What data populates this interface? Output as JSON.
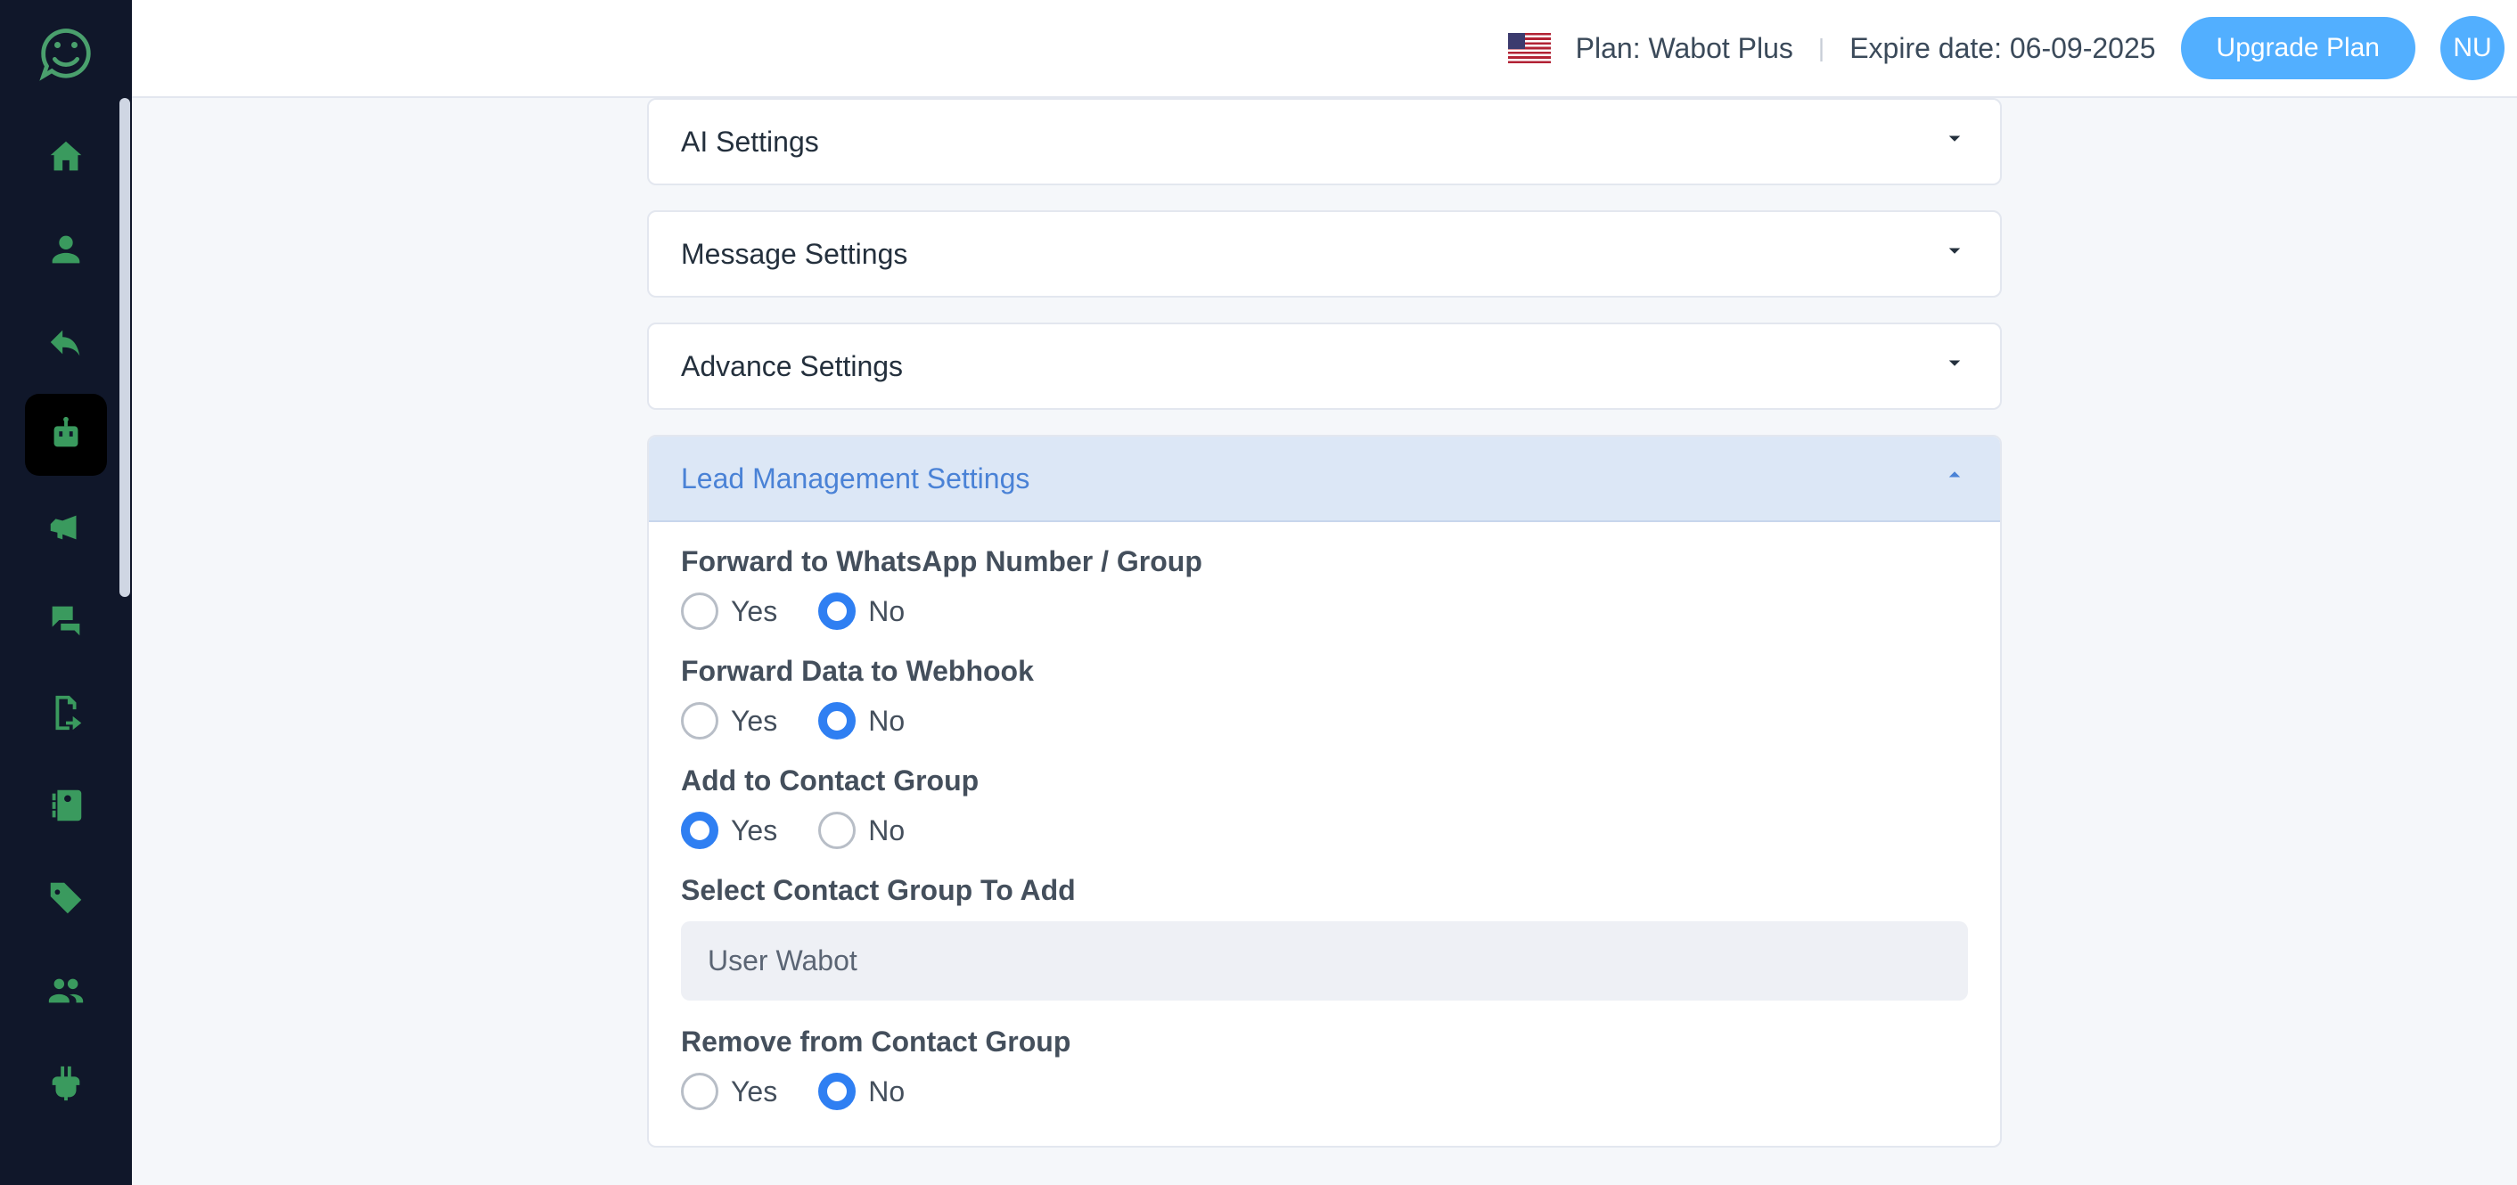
{
  "header": {
    "plan_prefix": "Plan: ",
    "plan_name": "Wabot Plus",
    "expire_prefix": "Expire date: ",
    "expire_date": "06-09-2025",
    "upgrade_label": "Upgrade Plan",
    "avatar_initials": "NU"
  },
  "sidebar": {
    "items": [
      {
        "name": "home",
        "active": false
      },
      {
        "name": "user",
        "active": false
      },
      {
        "name": "reply",
        "active": false
      },
      {
        "name": "bot",
        "active": true
      },
      {
        "name": "megaphone",
        "active": false
      },
      {
        "name": "chat",
        "active": false
      },
      {
        "name": "export",
        "active": false
      },
      {
        "name": "contacts",
        "active": false
      },
      {
        "name": "tags",
        "active": false
      },
      {
        "name": "group",
        "active": false
      },
      {
        "name": "plugin",
        "active": false
      }
    ]
  },
  "accordions": {
    "ai": {
      "title": "AI Settings",
      "expanded": false
    },
    "message": {
      "title": "Message Settings",
      "expanded": false
    },
    "advance": {
      "title": "Advance Settings",
      "expanded": false
    },
    "lead": {
      "title": "Lead Management Settings",
      "expanded": true
    }
  },
  "lead_settings": {
    "forward_whatsapp": {
      "label": "Forward to WhatsApp Number / Group",
      "options": {
        "yes": "Yes",
        "no": "No"
      },
      "selected": "no"
    },
    "forward_webhook": {
      "label": "Forward Data to Webhook",
      "options": {
        "yes": "Yes",
        "no": "No"
      },
      "selected": "no"
    },
    "add_contact_group": {
      "label": "Add to Contact Group",
      "options": {
        "yes": "Yes",
        "no": "No"
      },
      "selected": "yes"
    },
    "select_contact_group": {
      "label": "Select Contact Group To Add",
      "value": "User Wabot"
    },
    "remove_contact_group": {
      "label": "Remove from Contact Group",
      "options": {
        "yes": "Yes",
        "no": "No"
      },
      "selected": "no"
    }
  }
}
